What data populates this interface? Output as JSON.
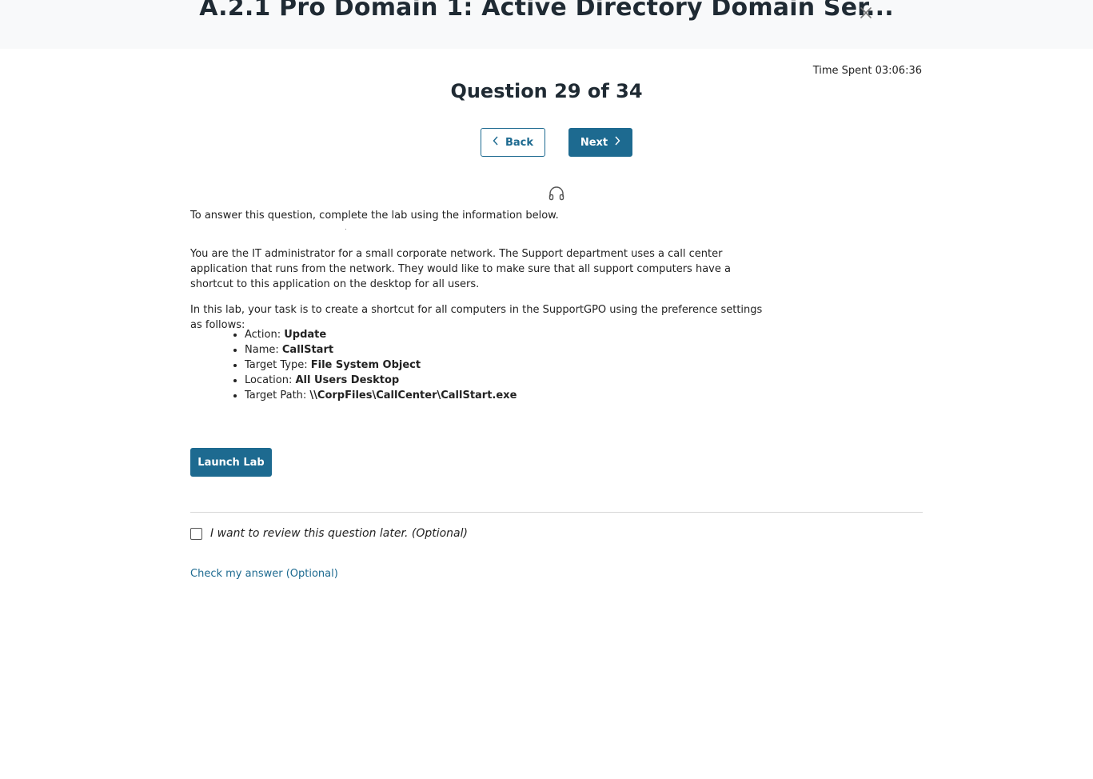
{
  "header": {
    "title": "A.2.1 Pro Domain 1: Active Directory Domain Ser...",
    "close_icon": "close-icon"
  },
  "timer": {
    "text": "Time Spent 03:06:36"
  },
  "question": {
    "heading": "Question 29 of 34"
  },
  "navigation": {
    "back_label": "Back",
    "next_label": "Next",
    "back_icon": "chevron-left-icon",
    "next_icon": "chevron-right-icon"
  },
  "audio_icon": "headphones-icon",
  "body": {
    "intro": "To answer this question, complete the lab using the information below.",
    "scenario": "You are the IT administrator for a small corporate network. The Support department uses a call center application that runs from the network. They would like to make sure that all support computers have a shortcut to this application on the desktop for all users.",
    "task": "In this lab, your task is to create a shortcut for all computers in the SupportGPO using the preference settings as follows:",
    "settings": [
      {
        "label": "Action: ",
        "value": "Update"
      },
      {
        "label": "Name: ",
        "value": "CallStart"
      },
      {
        "label": "Target Type: ",
        "value": "File System Object"
      },
      {
        "label": "Location: ",
        "value": "All Users Desktop"
      },
      {
        "label": "Target Path: ",
        "value": "\\\\CorpFiles\\CallCenter\\CallStart.exe"
      }
    ]
  },
  "launch_label": "Launch Lab",
  "review": {
    "label": "I want to review this question later. (Optional)",
    "checked": false
  },
  "check_answer_label": "Check my answer (Optional)",
  "colors": {
    "accent": "#1d6a90",
    "topbar_bg": "#f8f9fa",
    "divider": "#d7d7d7"
  }
}
